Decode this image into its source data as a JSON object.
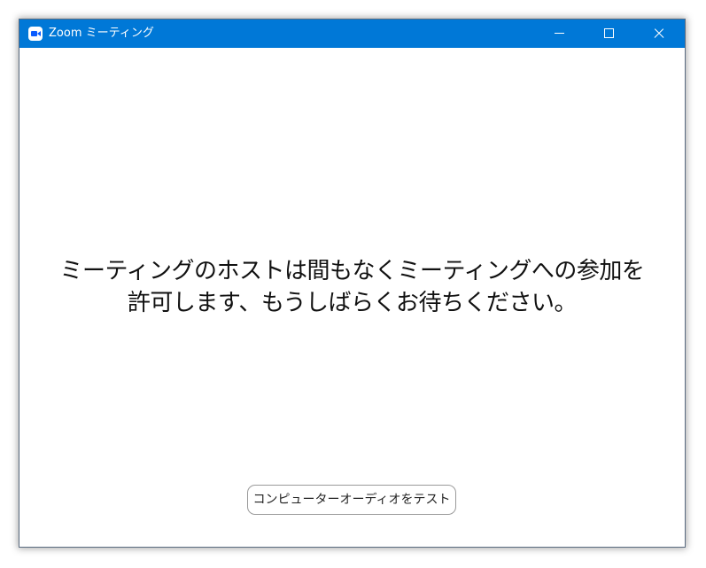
{
  "window": {
    "title": "Zoom ミーティング",
    "accent_color": "#0078d7",
    "icons": {
      "app": "zoom-camera-icon",
      "minimize": "minimize-icon",
      "maximize": "maximize-icon",
      "close": "close-icon"
    }
  },
  "main": {
    "message_line1": "ミーティングのホストは間もなくミーティングへの参加を",
    "message_line2": "許可します、もうしばらくお待ちください。",
    "test_audio_label": "コンピューターオーディオをテスト"
  }
}
